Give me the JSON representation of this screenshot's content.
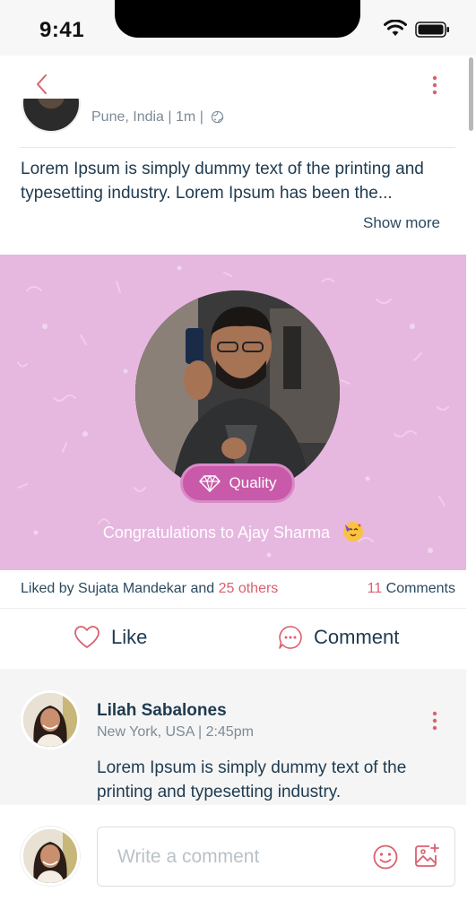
{
  "status_bar": {
    "time": "9:41"
  },
  "post": {
    "location": "Pune, India",
    "time_ago": "1m",
    "body": "Lorem Ipsum is simply dummy text of the printing and typesetting industry. Lorem Ipsum has been the...",
    "show_more_label": "Show more"
  },
  "congrats": {
    "badge_label": "Quality",
    "message": "Congratulations to Ajay Sharma"
  },
  "likes": {
    "prefix": "Liked by Sujata Mandekar and ",
    "others": "25 others",
    "comment_count": "11",
    "comments_label": " Comments"
  },
  "actions": {
    "like_label": "Like",
    "comment_label": "Comment"
  },
  "comment": {
    "author": "Lilah Sabalones",
    "location": "New York, USA",
    "time": "2:45pm",
    "text": "Lorem Ipsum is simply dummy text of the printing and typesetting industry."
  },
  "composer": {
    "placeholder": "Write a comment"
  },
  "colors": {
    "accent": "#d9616f",
    "card_bg": "#e6b8e0",
    "badge": "#c85aa9",
    "text_dark": "#1e3a4f"
  },
  "icons": [
    "back-icon",
    "more-vertical-icon",
    "globe-icon",
    "diamond-icon",
    "party-emoji",
    "heart-icon",
    "chat-bubble-icon",
    "smiley-icon",
    "image-add-icon",
    "wifi-icon",
    "battery-icon"
  ]
}
